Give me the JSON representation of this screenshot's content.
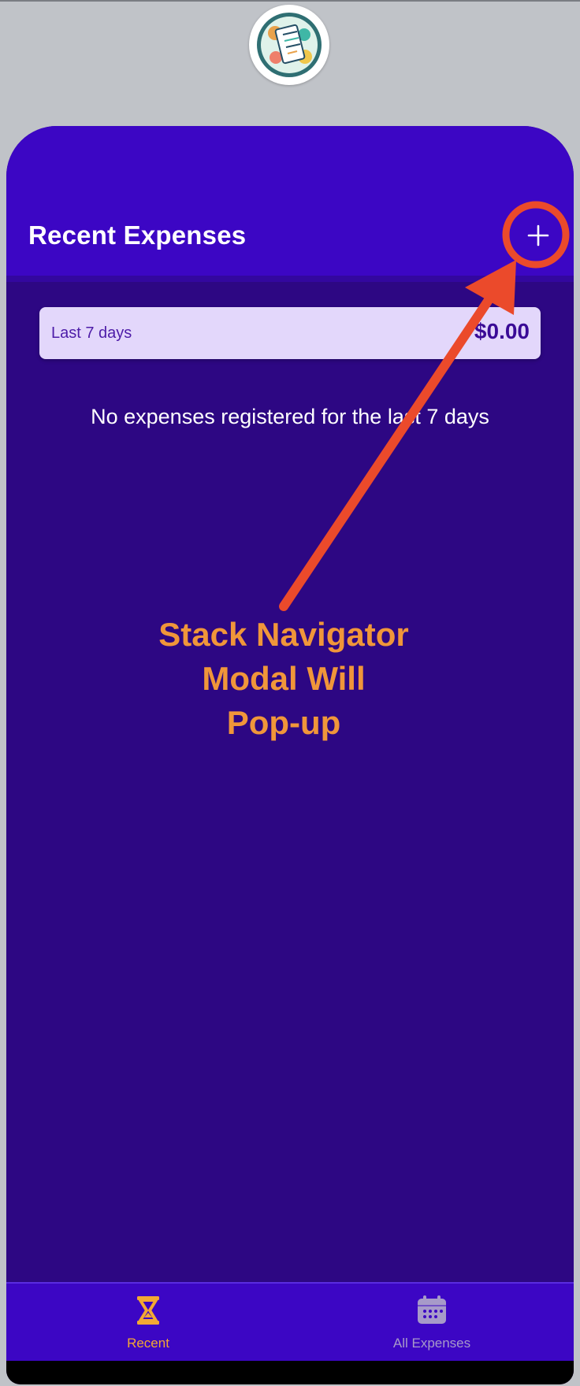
{
  "header": {
    "title": "Recent Expenses",
    "add_icon": "plus-icon"
  },
  "summary": {
    "period": "Last 7 days",
    "sum": "$0.00"
  },
  "main": {
    "fallback_text": "No expenses registered for the last 7 days"
  },
  "tabs": [
    {
      "label": "Recent",
      "icon": "hourglass-icon",
      "active": true
    },
    {
      "label": "All Expenses",
      "icon": "calendar-icon",
      "active": false
    }
  ],
  "annotation": {
    "lines": [
      "Stack Navigator",
      "Modal Will",
      "Pop-up"
    ]
  },
  "colors": {
    "header": "#3c06c4",
    "background": "#2d0783",
    "card": "#e3d7fb",
    "active_tab": "#f3a833",
    "inactive_tab": "#a79ac9",
    "annotation": "#f0963a",
    "annotation_arrow": "#eb4a2b"
  }
}
